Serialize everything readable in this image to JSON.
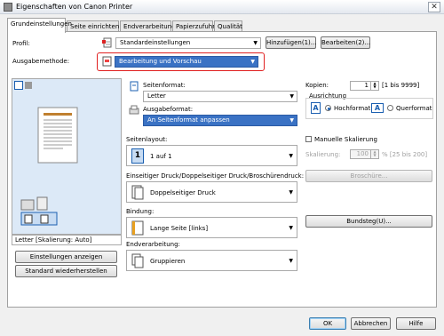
{
  "window": {
    "title": "Eigenschaften von Canon Printer",
    "close_glyph": "✕"
  },
  "tabs": [
    {
      "label": "Grundeinstellungen"
    },
    {
      "label": "Seite einrichten"
    },
    {
      "label": "Endverarbeitung"
    },
    {
      "label": "Papierzufuhr"
    },
    {
      "label": "Qualität"
    }
  ],
  "profile": {
    "label": "Profil:",
    "value": "Standardeinstellungen",
    "add_button": "Hinzufügen(1)...",
    "edit_button": "Bearbeiten(2)..."
  },
  "output_method": {
    "label": "Ausgabemethode:",
    "value": "Bearbeitung und Vorschau"
  },
  "preview": {
    "status_text": "Letter [Skalierung: Auto]",
    "show_settings_button": "Einstellungen anzeigen",
    "restore_defaults_button": "Standard wiederherstellen"
  },
  "page_format": {
    "label": "Seitenformat:",
    "value": "Letter"
  },
  "output_format": {
    "label": "Ausgabeformat:",
    "value": "An Seitenformat anpassen"
  },
  "page_layout": {
    "label": "Seitenlayout:",
    "value": "1 auf 1",
    "icon_text": "1"
  },
  "duplex": {
    "label": "Einseitiger Druck/Doppelseitiger Druck/Broschürendruck:",
    "value": "Doppelseitiger Druck"
  },
  "binding": {
    "label": "Bindung:",
    "value": "Lange Seite [links]"
  },
  "finishing": {
    "label": "Endverarbeitung:",
    "value": "Gruppieren"
  },
  "copies": {
    "label": "Kopien:",
    "value": "1",
    "range": "[1 bis 9999]"
  },
  "orientation": {
    "label": "Ausrichtung",
    "portrait": "Hochformat",
    "landscape": "Querformat",
    "selected": "portrait"
  },
  "manual_scaling": {
    "label": "Manuelle Skalierung",
    "checked": false
  },
  "scaling": {
    "label": "Skalierung:",
    "value": "100",
    "range": "% [25 bis 200]"
  },
  "brochure_button": "Broschüre...",
  "gutter_button": "Bundsteg(U)...",
  "footer": {
    "ok": "OK",
    "cancel": "Abbrechen",
    "help": "Hilfe"
  }
}
